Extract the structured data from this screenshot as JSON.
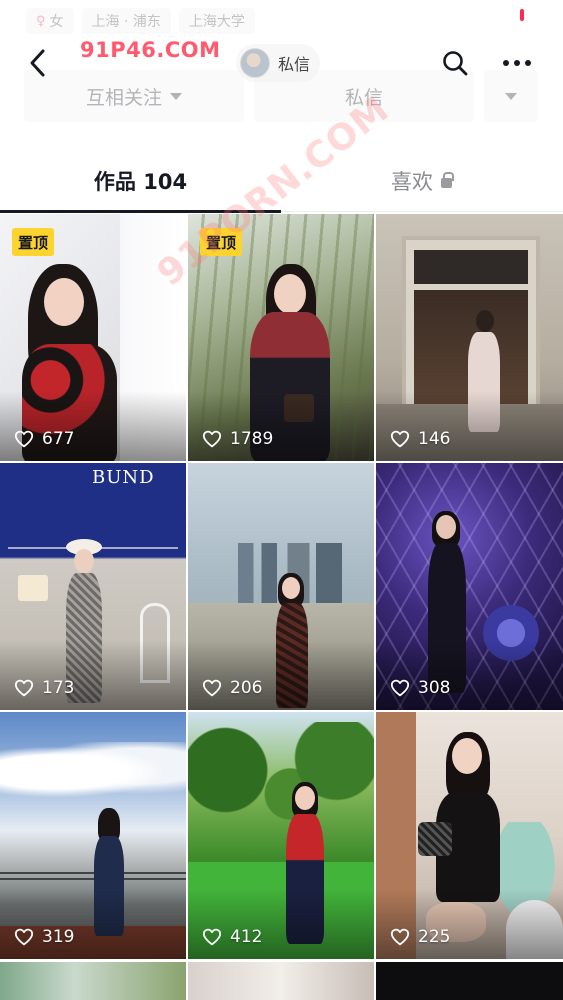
{
  "profile_tags": [
    {
      "icon": "female-icon",
      "label": "女"
    },
    {
      "label": "上海 · 浦东"
    },
    {
      "label": "上海大学"
    }
  ],
  "header": {
    "watermark": "91P46.COM",
    "chip_label": "私信"
  },
  "faded_actions": {
    "mutual_follow": "互相关注",
    "message": "私信"
  },
  "watermark_diagonal": "91PORN.COM",
  "tabs": [
    {
      "label": "作品 104",
      "active": true
    },
    {
      "label": "喜欢",
      "locked": true
    }
  ],
  "videos": [
    {
      "pinned": true,
      "pin_label": "置顶",
      "likes": "677"
    },
    {
      "pinned": true,
      "pin_label": "置顶",
      "likes": "1789"
    },
    {
      "pinned": false,
      "likes": "146"
    },
    {
      "pinned": false,
      "likes": "173",
      "overlay_text": "BUND"
    },
    {
      "pinned": false,
      "likes": "206"
    },
    {
      "pinned": false,
      "likes": "308"
    },
    {
      "pinned": false,
      "likes": "319"
    },
    {
      "pinned": false,
      "likes": "412"
    },
    {
      "pinned": false,
      "likes": "225"
    }
  ],
  "colors": {
    "accent": "#fe2c55",
    "pin_badge": "#fdd32e",
    "text_primary": "#161823",
    "text_secondary": "#8a8b91"
  }
}
